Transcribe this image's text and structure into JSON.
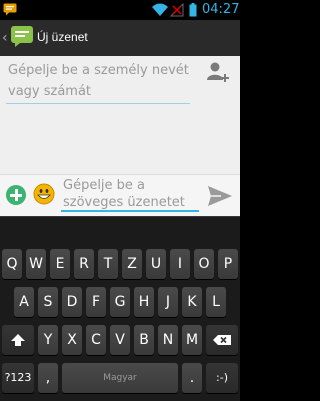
{
  "status_bar": {
    "time": "04:27",
    "icons": [
      "sms-notification-icon",
      "wifi-icon",
      "no-signal-icon",
      "battery-icon"
    ],
    "time_color": "#33b5e5"
  },
  "action_bar": {
    "title": "Új üzenet",
    "back_icon": "chevron-left-icon",
    "app_icon": "messaging-icon"
  },
  "recipient": {
    "placeholder": "Gépelje be a személy nevét vagy számát",
    "add_contact_icon": "add-contact-icon"
  },
  "composer": {
    "placeholder": "Gépelje be a szöveges üzenetet",
    "attach_icon": "plus-icon",
    "emoji_icon": "smiley-icon",
    "send_icon": "send-icon"
  },
  "keyboard": {
    "rows": [
      [
        "Q",
        "W",
        "E",
        "R",
        "T",
        "Z",
        "U",
        "I",
        "O",
        "P"
      ],
      [
        "A",
        "S",
        "D",
        "F",
        "G",
        "H",
        "J",
        "K",
        "L"
      ],
      [
        "Y",
        "X",
        "C",
        "V",
        "B",
        "N",
        "M"
      ]
    ],
    "shift_icon": "shift-icon",
    "backspace_icon": "backspace-icon",
    "symbols_label": "?123",
    "comma_label": ",",
    "space_label": "Magyar",
    "smiley_label": ":-)"
  }
}
